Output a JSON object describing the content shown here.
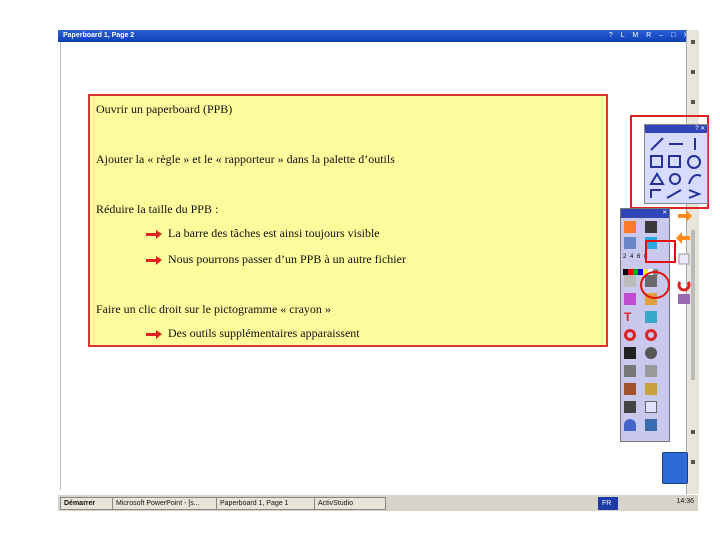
{
  "window": {
    "title": "Paperboard 1, Page 2",
    "controls": "? L M R – □ ✕"
  },
  "callout": {
    "line1": "Ouvrir un paperboard (PPB)",
    "line2": "Ajouter la « règle » et le « rapporteur » dans la palette d’outils",
    "line3": "Réduire la taille du PPB :",
    "line3a": "La barre des tâches est ainsi toujours visible",
    "line3b": "Nous pourrons passer d’un PPB à un autre fichier",
    "line4": "Faire un clic droit sur le pictogramme « crayon »",
    "line4a": "Des outils supplémentaires apparaissent"
  },
  "tools": {
    "numbers": "2 4 6 8",
    "swatches": [
      "#000000",
      "#ff0000",
      "#00a000",
      "#0000ff",
      "#ffff00",
      "#ffffff",
      "#888888"
    ]
  },
  "taskbar": {
    "start": "Démarrer",
    "items": [
      "Microsoft PowerPoint - [s...",
      "Paperboard 1, Page 1",
      "ActivStudio"
    ],
    "tray_lang": "FR",
    "clock": "14:36"
  },
  "colors": {
    "accent_red": "#e02020",
    "callout_bg": "#fdfc9c",
    "title_blue": "#0d3fb5"
  }
}
